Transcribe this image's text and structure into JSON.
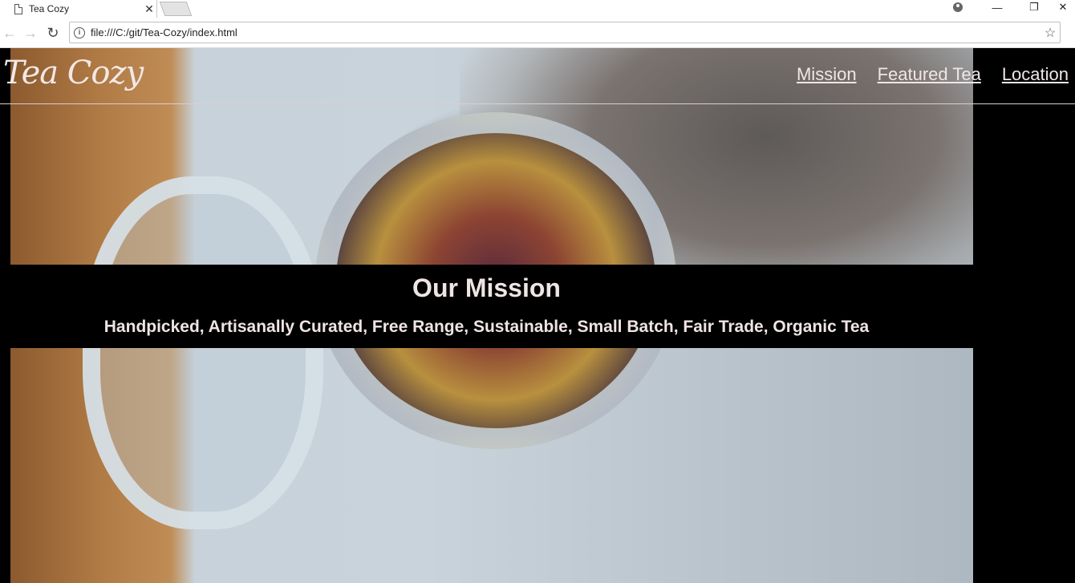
{
  "browser": {
    "tab_title": "Tea Cozy",
    "url": "file:///C:/git/Tea-Cozy/index.html"
  },
  "site": {
    "brand": "Tea Cozy",
    "nav": [
      "Mission",
      "Featured Tea",
      "Location"
    ]
  },
  "mission": {
    "title": "Our Mission",
    "subtitle": "Handpicked, Artisanally Curated, Free Range, Sustainable, Small Batch, Fair Trade, Organic Tea"
  }
}
